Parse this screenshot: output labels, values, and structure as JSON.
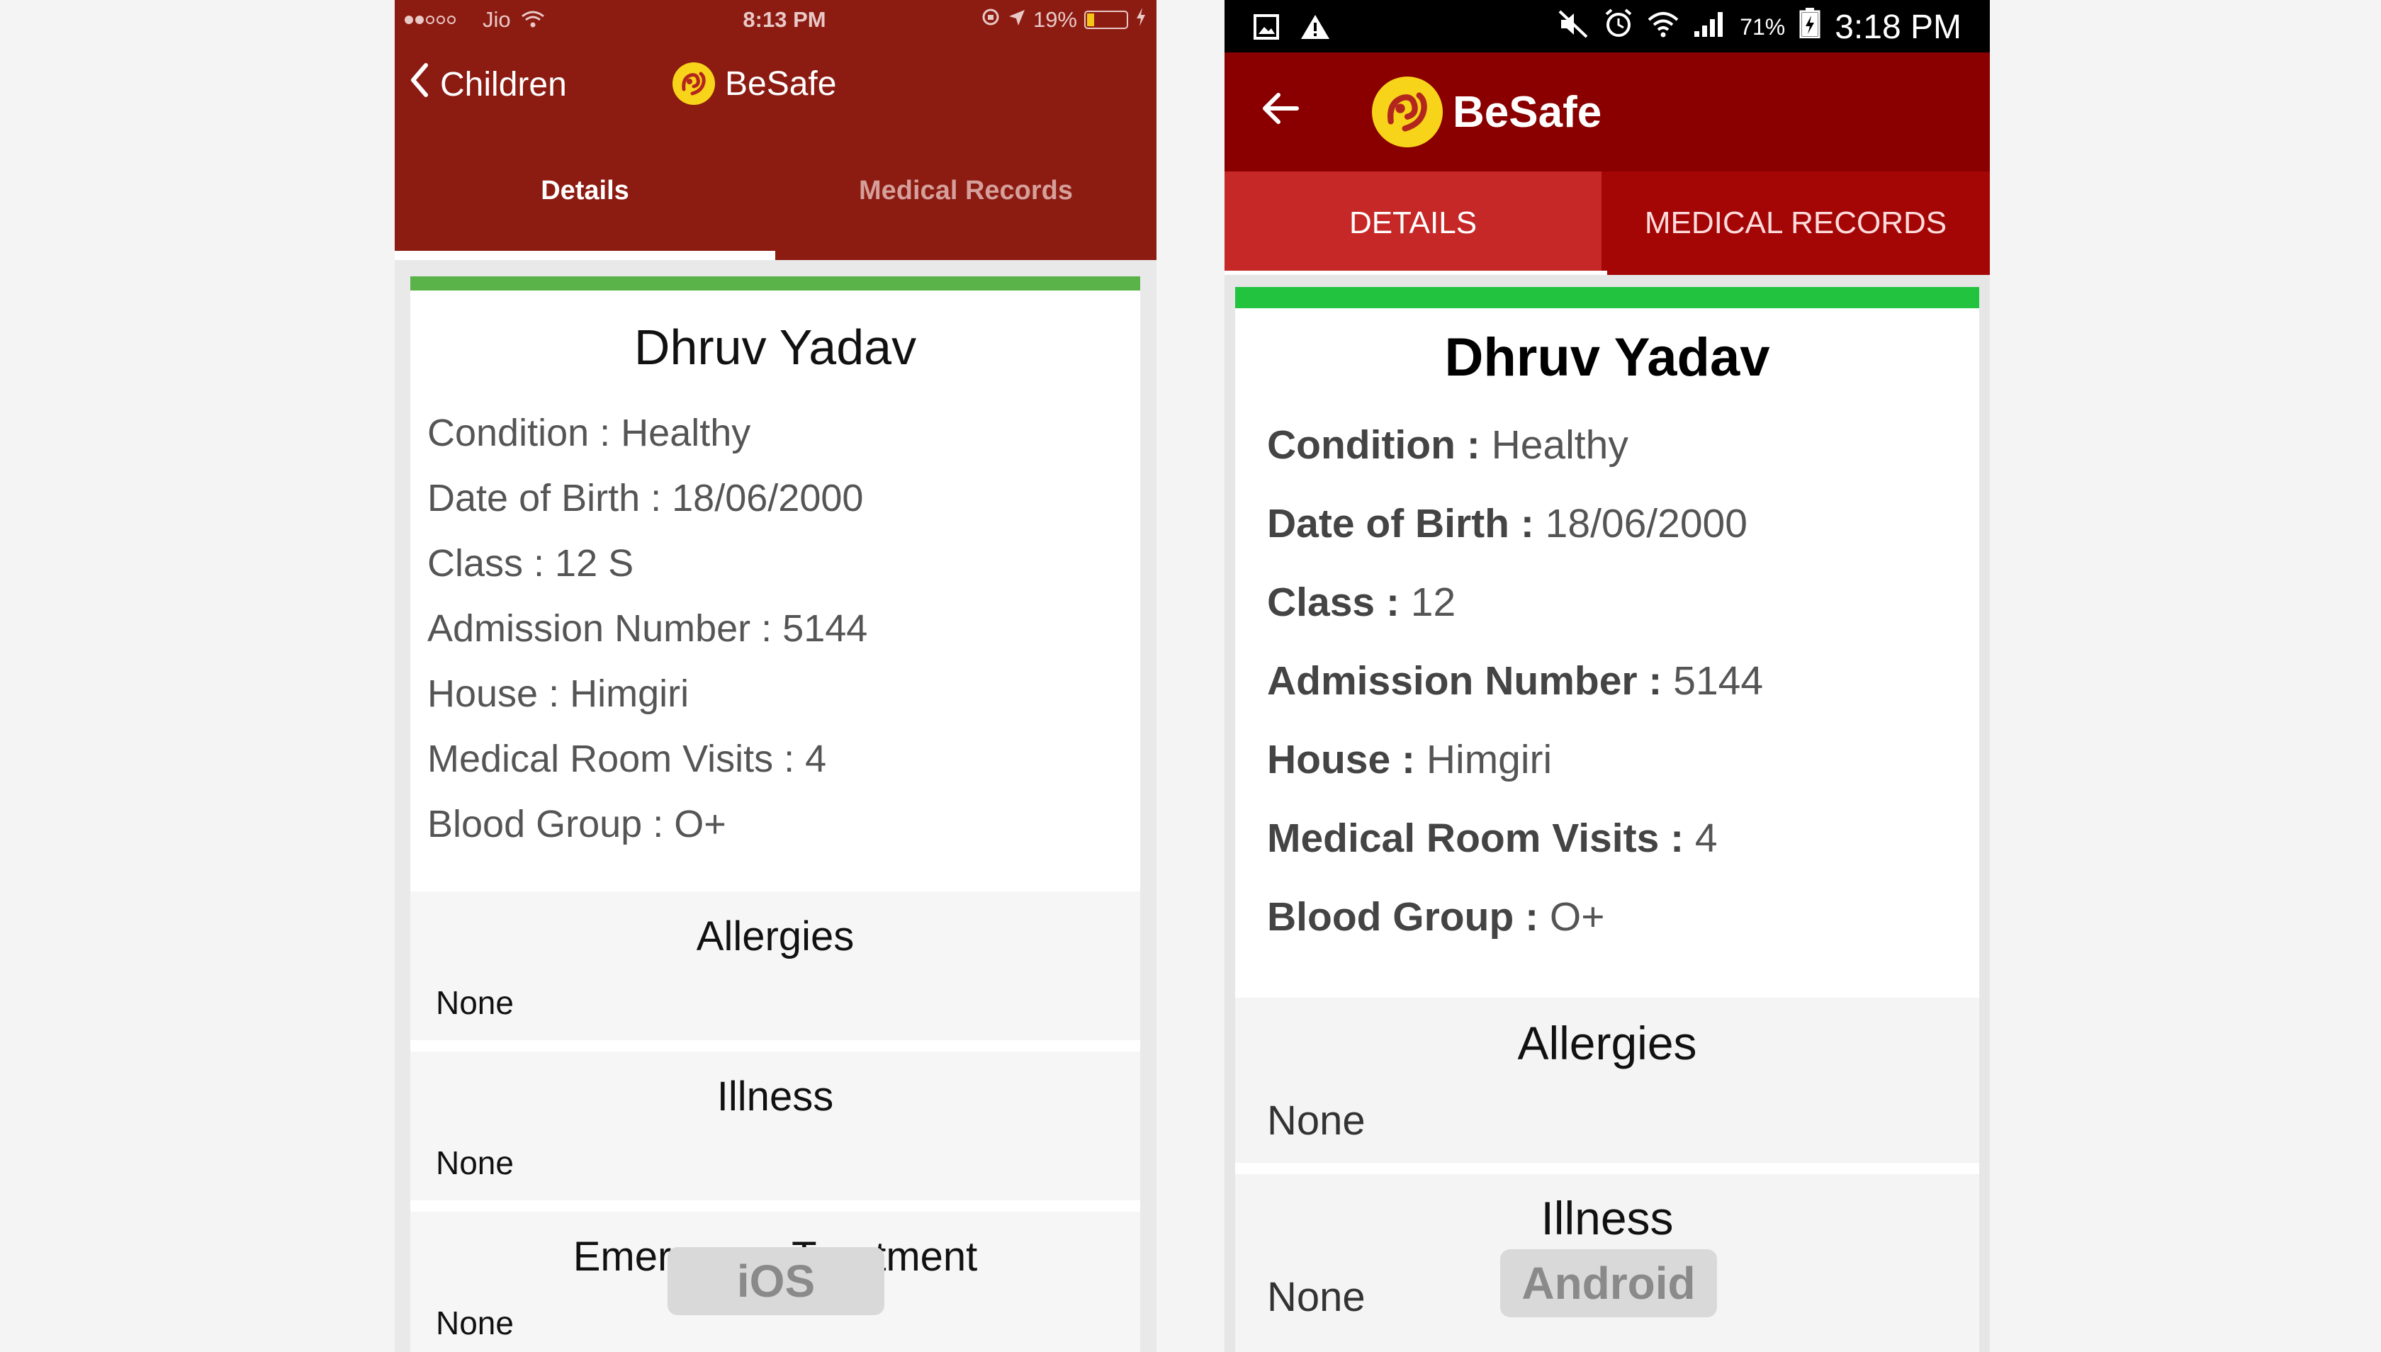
{
  "ios": {
    "status": {
      "carrier": "Jio",
      "time": "8:13 PM",
      "battery": "19%",
      "battery_level": 0.19
    },
    "nav": {
      "back_label": "Children",
      "brand": "BeSafe"
    },
    "tabs": [
      "Details",
      "Medical Records"
    ],
    "student": {
      "name": "Dhruv Yadav",
      "rows": [
        "Condition : Healthy",
        "Date of Birth : 18/06/2000",
        "Class : 12 S",
        "Admission Number : 5144",
        "House : Himgiri",
        "Medical Room Visits : 4",
        "Blood Group : O+"
      ]
    },
    "sections": [
      {
        "title": "Allergies",
        "value": "None"
      },
      {
        "title": "Illness",
        "value": "None"
      },
      {
        "title": "Emergency Treatment",
        "value": "None"
      }
    ],
    "badge": "iOS"
  },
  "android": {
    "status": {
      "battery": "71%",
      "time": "3:18 PM"
    },
    "appbar": {
      "brand": "BeSafe"
    },
    "tabs": [
      "DETAILS",
      "MEDICAL RECORDS"
    ],
    "student": {
      "name": "Dhruv Yadav",
      "rows": [
        {
          "label": "Condition :",
          "value": " Healthy"
        },
        {
          "label": "Date of Birth :",
          "value": " 18/06/2000"
        },
        {
          "label": "Class :",
          "value": " 12"
        },
        {
          "label": "Admission Number :",
          "value": " 5144"
        },
        {
          "label": "House :",
          "value": " Himgiri"
        },
        {
          "label": "Medical Room Visits :",
          "value": " 4"
        },
        {
          "label": "Blood Group :",
          "value": " O+"
        }
      ]
    },
    "sections": [
      {
        "title": "Allergies",
        "value": "None"
      },
      {
        "title": "Illness",
        "value": "None"
      }
    ],
    "badge": "Android"
  },
  "colors": {
    "ios_header": "#8c1b12",
    "android_appbar": "#8a0000",
    "android_tabs": "#c62828",
    "green_bar": "#5ab349",
    "logo_yellow": "#f7d41a"
  },
  "icons": [
    "wifi-icon",
    "location-icon",
    "battery-icon",
    "back-chevron-icon",
    "besafe-logo-icon",
    "back-arrow-icon",
    "mute-icon",
    "alarm-icon",
    "signal-icon",
    "image-icon",
    "warning-icon"
  ]
}
